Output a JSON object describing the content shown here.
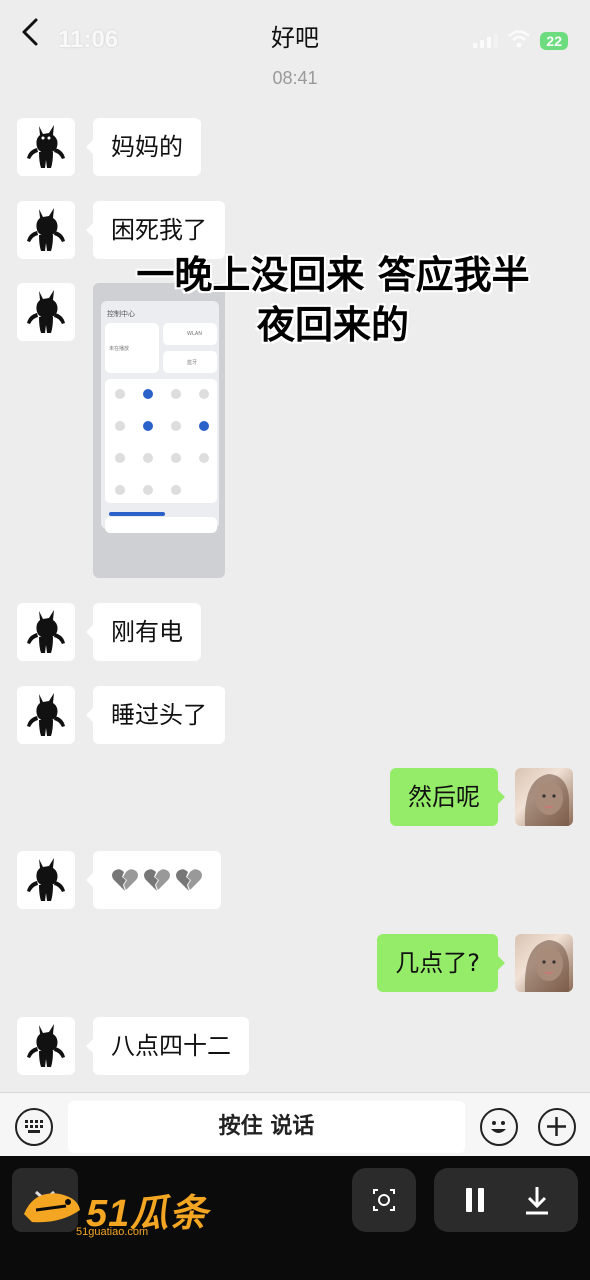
{
  "status_bar": {
    "time": "11:06",
    "battery": "22"
  },
  "header": {
    "title": "好吧"
  },
  "timestamp": "08:41",
  "messages_in": [
    {
      "text": "妈妈的"
    },
    {
      "text": "困死我了"
    },
    {
      "text": "刚有电"
    },
    {
      "text": "睡过头了"
    },
    {
      "text": "八点四十二"
    }
  ],
  "messages_out": [
    {
      "text": "然后呢"
    },
    {
      "text": "几点了?"
    }
  ],
  "image_message": {
    "title": "控制中心",
    "tiles": [
      "WLAN",
      "蓝牙",
      "未在播放"
    ]
  },
  "emoji_message": {
    "icons": [
      "broken-heart",
      "broken-heart",
      "broken-heart"
    ]
  },
  "overlay_caption": {
    "line1": "一晚上没回来 答应我半",
    "line2": "夜回来的"
  },
  "input_bar": {
    "hold_to_talk": "按住 说话"
  },
  "watermark": {
    "brand": "51瓜条",
    "site": "51guatiao.com"
  },
  "colors": {
    "outgoing_bubble": "#95ec69",
    "background": "#ededed",
    "accent_logo": "#f4a623"
  }
}
